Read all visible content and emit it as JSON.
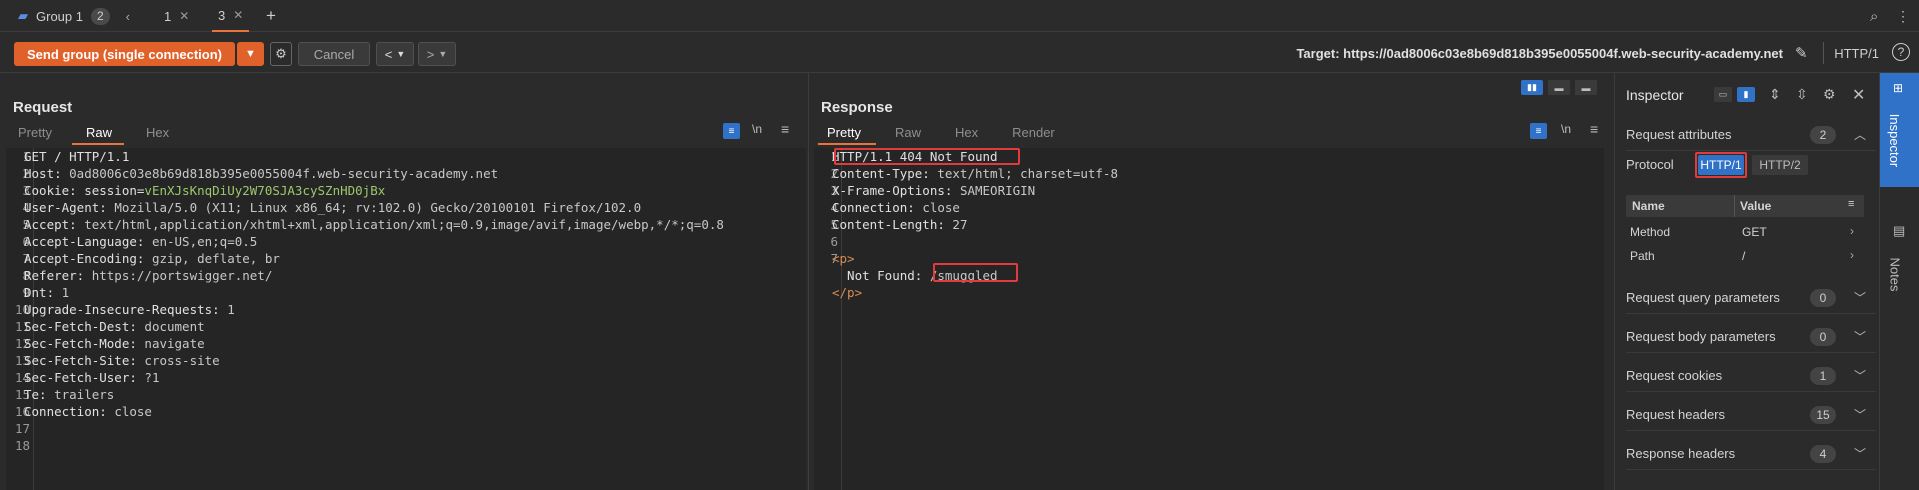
{
  "tabs": {
    "group_label": "Group 1",
    "group_count": "2",
    "back_chevron": "‹",
    "tab1": "1",
    "tab3": "3",
    "add": "+"
  },
  "toolbar": {
    "send_label": "Send group (single connection)",
    "cancel_label": "Cancel",
    "target": "Target: https://0ad8006c03e8b69d818b395e0055004f.web-security-academy.net",
    "protocol": "HTTP/1",
    "help": "?"
  },
  "request": {
    "title": "Request",
    "tabs": [
      "Pretty",
      "Raw",
      "Hex"
    ],
    "active_tab": "Raw",
    "newline_toggle": "\\n",
    "lines": [
      {
        "n": "1",
        "k": "GET / HTTP/1.1",
        "v": "",
        "cls": "k"
      },
      {
        "n": "2",
        "k": "Host: ",
        "v": "0ad8006c03e8b69d818b395e0055004f.web-security-academy.net",
        "cls": "v"
      },
      {
        "n": "3",
        "k": "Cookie: session=",
        "v": "vEnXJsKnqDiUy2W70SJA3cySZnHD0jBx",
        "cls": "cookie"
      },
      {
        "n": "4",
        "k": "User-Agent: ",
        "v": "Mozilla/5.0 (X11; Linux x86_64; rv:102.0) Gecko/20100101 Firefox/102.0",
        "cls": "v"
      },
      {
        "n": "5",
        "k": "Accept: ",
        "v": "text/html,application/xhtml+xml,application/xml;q=0.9,image/avif,image/webp,*/*;q=0.8",
        "cls": "v"
      },
      {
        "n": "6",
        "k": "Accept-Language: ",
        "v": "en-US,en;q=0.5",
        "cls": "v"
      },
      {
        "n": "7",
        "k": "Accept-Encoding: ",
        "v": "gzip, deflate, br",
        "cls": "v"
      },
      {
        "n": "8",
        "k": "Referer: ",
        "v": "https://portswigger.net/",
        "cls": "v"
      },
      {
        "n": "9",
        "k": "Dnt: ",
        "v": "1",
        "cls": "v"
      },
      {
        "n": "10",
        "k": "Upgrade-Insecure-Requests: ",
        "v": "1",
        "cls": "v"
      },
      {
        "n": "11",
        "k": "Sec-Fetch-Dest: ",
        "v": "document",
        "cls": "v"
      },
      {
        "n": "12",
        "k": "Sec-Fetch-Mode: ",
        "v": "navigate",
        "cls": "v"
      },
      {
        "n": "13",
        "k": "Sec-Fetch-Site: ",
        "v": "cross-site",
        "cls": "v"
      },
      {
        "n": "14",
        "k": "Sec-Fetch-User: ",
        "v": "?1",
        "cls": "v"
      },
      {
        "n": "15",
        "k": "Te: ",
        "v": "trailers",
        "cls": "v"
      },
      {
        "n": "16",
        "k": "Connection: ",
        "v": "close",
        "cls": "v"
      },
      {
        "n": "17",
        "k": "",
        "v": "",
        "cls": "v"
      },
      {
        "n": "18",
        "k": "",
        "v": "",
        "cls": "v"
      }
    ]
  },
  "response": {
    "title": "Response",
    "tabs": [
      "Pretty",
      "Raw",
      "Hex",
      "Render"
    ],
    "active_tab": "Pretty",
    "newline_toggle": "\\n",
    "lines": [
      {
        "n": "1",
        "k": "HTTP/1.1 404 Not Found",
        "v": "",
        "cls": "k"
      },
      {
        "n": "2",
        "k": "Content-Type: ",
        "v": "text/html; charset=utf-8",
        "cls": "v"
      },
      {
        "n": "3",
        "k": "X-Frame-Options: ",
        "v": "SAMEORIGIN",
        "cls": "v"
      },
      {
        "n": "4",
        "k": "Connection: ",
        "v": "close",
        "cls": "v"
      },
      {
        "n": "5",
        "k": "Content-Length: ",
        "v": "27",
        "cls": "v"
      },
      {
        "n": "6",
        "k": "",
        "v": "",
        "cls": "v"
      },
      {
        "n": "7",
        "k": "",
        "v": "<p>",
        "cls": "tag"
      },
      {
        "n": "",
        "k": "  Not Found: ",
        "v": "/smuggled",
        "cls": "v"
      },
      {
        "n": "",
        "k": "",
        "v": "</p>",
        "cls": "tag"
      }
    ]
  },
  "inspector": {
    "title": "Inspector",
    "request_attributes": "Request attributes",
    "request_attributes_count": "2",
    "protocol_label": "Protocol",
    "protocol_options": [
      "HTTP/1",
      "HTTP/2"
    ],
    "table_headers": [
      "Name",
      "Value"
    ],
    "attributes": [
      {
        "name": "Method",
        "value": "GET"
      },
      {
        "name": "Path",
        "value": "/"
      }
    ],
    "sections": [
      {
        "label": "Request query parameters",
        "count": "0"
      },
      {
        "label": "Request body parameters",
        "count": "0"
      },
      {
        "label": "Request cookies",
        "count": "1"
      },
      {
        "label": "Request headers",
        "count": "15"
      },
      {
        "label": "Response headers",
        "count": "4"
      }
    ]
  },
  "side_tabs": [
    "Inspector",
    "Notes"
  ],
  "colors": {
    "accent": "#e0622a",
    "highlight_red": "#e23b3b",
    "selected_blue": "#2f72c7"
  }
}
